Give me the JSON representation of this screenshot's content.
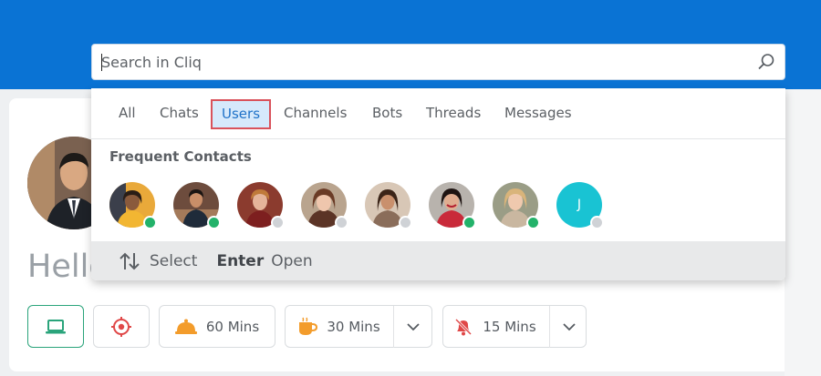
{
  "search": {
    "placeholder": "Search in Cliq"
  },
  "tabs": [
    "All",
    "Chats",
    "Users",
    "Channels",
    "Bots",
    "Threads",
    "Messages"
  ],
  "selected_tab": "Users",
  "frequent_contacts": {
    "title": "Frequent Contacts",
    "contacts": [
      {
        "status": "online"
      },
      {
        "status": "online"
      },
      {
        "status": "offline"
      },
      {
        "status": "offline"
      },
      {
        "status": "offline"
      },
      {
        "status": "online"
      },
      {
        "status": "online"
      },
      {
        "status": "offline",
        "initial": "J"
      }
    ]
  },
  "footer": {
    "select_label": "Select",
    "enter_key": "Enter",
    "open_label": "Open"
  },
  "greeting": "Hello,",
  "status_buttons": {
    "b1": "60 Mins",
    "b2": "30 Mins",
    "b3": "15 Mins"
  },
  "colors": {
    "brand": "#0a73d4",
    "online": "#23b26a",
    "selected_tab_border": "#d9525b",
    "selected_tab_bg": "#d6e9fb",
    "initial_avatar": "#19c3d3"
  }
}
